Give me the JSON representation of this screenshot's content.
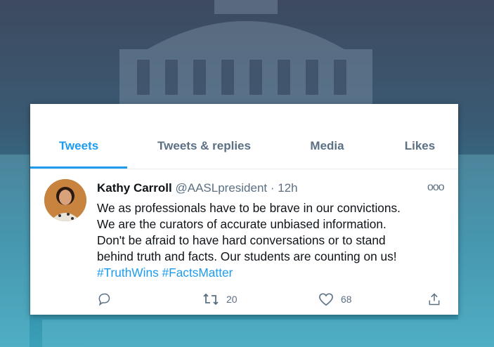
{
  "tabs": [
    "Tweets",
    "Tweets & replies",
    "Media",
    "Likes"
  ],
  "tweet": {
    "author_name": "Kathy Carroll",
    "handle": "@AASLpresident",
    "separator": " · ",
    "time": "12h",
    "more_label": "ooo",
    "lines": [
      "We as professionals have to be brave in our convictions.",
      "We are the curators of accurate unbiased information.",
      "Don't be afraid to have hard conversations or to stand",
      "behind truth and facts. Our students are counting on us!"
    ],
    "hashtags": [
      "#TruthWins",
      "#FactsMatter"
    ],
    "retweet_count": "20",
    "like_count": "68"
  },
  "colors": {
    "accent": "#1d9bf0",
    "muted": "#5b7083"
  },
  "icons": [
    "reply-icon",
    "retweet-icon",
    "like-icon",
    "share-icon"
  ]
}
